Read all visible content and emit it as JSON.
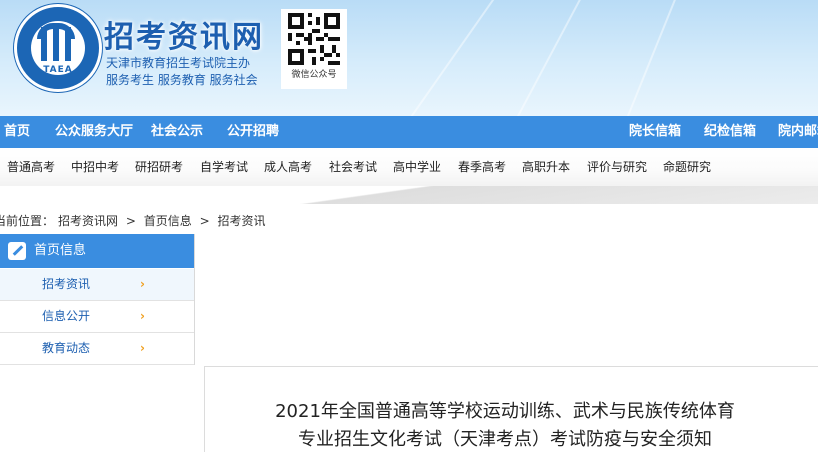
{
  "header": {
    "site_title": "招考资讯网",
    "org_name": "天津市教育招生考试院主办",
    "slogan": "服务考生 服务教育 服务社会",
    "logo_abbr": "TAEA",
    "qr_caption": "微信公众号"
  },
  "main_nav": {
    "left": [
      "首页",
      "公众服务大厅",
      "社会公示",
      "公开招聘"
    ],
    "right": [
      "院长信箱",
      "纪检信箱",
      "院内邮箱"
    ]
  },
  "sub_nav": [
    "普通高考",
    "中招中考",
    "研招研考",
    "自学考试",
    "成人高考",
    "社会考试",
    "高中学业",
    "春季高考",
    "高职升本",
    "评价与研究",
    "命题研究"
  ],
  "breadcrumb": {
    "prefix": "当前位置：",
    "items": [
      "招考资讯网",
      "首页信息",
      "招考资讯"
    ],
    "separator": ">"
  },
  "sidebar": {
    "heading": "首页信息",
    "items": [
      {
        "label": "招考资讯",
        "active": true
      },
      {
        "label": "信息公开",
        "active": false
      },
      {
        "label": "教育动态",
        "active": false
      }
    ],
    "chevron": "›"
  },
  "article": {
    "title_line1": "2021年全国普通高等学校运动训练、武术与民族传统体育",
    "title_line2": "专业招生文化考试（天津考点）考试防疫与安全须知"
  },
  "colors": {
    "nav_blue": "#3a8de0",
    "brand_blue": "#1d5fb0",
    "chevron_orange": "#f0a020"
  }
}
